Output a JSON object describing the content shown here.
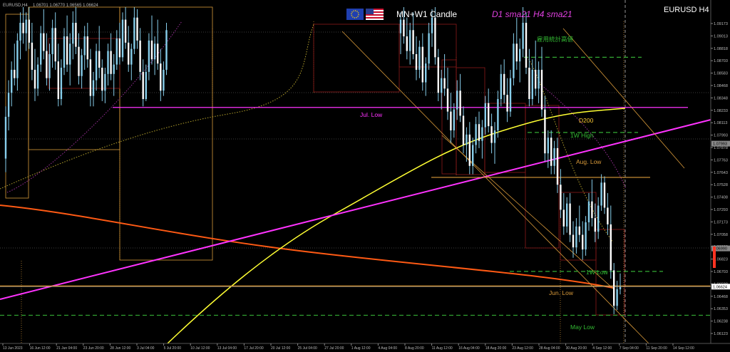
{
  "window": {
    "symbol_header": "EURUSD,H4",
    "ohlc_readout": "1.06701 1.06770 1.06565 1.06624",
    "symbol_title": "EURUSD H4",
    "indicator_label_1": "MN+W1 Candle",
    "indicator_label_2": "D1 sma21 H4 sma21"
  },
  "colors": {
    "background": "#000000",
    "candle": "#87ceeb",
    "magenta_line": "#ff33ff",
    "yellow_ma": "#ffff33",
    "orange_ma": "#ff5a14",
    "level_orange": "#d99a3a",
    "level_green": "#33aa33",
    "box_red": "#8b1a1a",
    "dotted_olive": "#b5a22c",
    "dotted_purple": "#9a2f9a"
  },
  "chart_data": {
    "type": "candlestick",
    "title": "EURUSD H4",
    "ylim": [
      1.0608,
      1.093
    ],
    "y_ticks": [
      "1.09173",
      "1.09013",
      "1.08818",
      "1.08703",
      "1.08583",
      "1.08468",
      "1.08348",
      "1.08233",
      "1.08113",
      "1.07993",
      "1.07878",
      "1.07763",
      "1.07643",
      "1.07528",
      "1.07408",
      "1.07293",
      "1.07173",
      "1.07058",
      "1.06938",
      "1.06823",
      "1.06703",
      "1.06588",
      "1.06468",
      "1.06353",
      "1.06238",
      "1.06123"
    ],
    "x_ticks": [
      "13 Jun 2023",
      "16 Jun 12:00",
      "21 Jun 04:00",
      "23 Jun 20:00",
      "28 Jun 12:00",
      "3 Jul 04:00",
      "5 Jul 20:00",
      "10 Jul 12:00",
      "13 Jul 04:00",
      "17 Jul 20:00",
      "20 Jul 12:00",
      "25 Jul 04:00",
      "27 Jul 20:00",
      "1 Aug 12:00",
      "4 Aug 04:00",
      "8 Aug 20:00",
      "11 Aug 12:00",
      "16 Aug 04:00",
      "18 Aug 20:00",
      "23 Aug 12:00",
      "28 Aug 04:00",
      "30 Aug 20:00",
      "4 Sep 12:00",
      "7 Sep 04:00",
      "11 Sep 20:00",
      "14 Sep 12:00"
    ],
    "current_price": "1.06624",
    "price_markers": [
      "1.07993",
      "1.06990"
    ],
    "levels": [
      {
        "label": "Jul. Low",
        "price": 1.0834,
        "color": "magenta"
      },
      {
        "label": "D200",
        "price": 1.0825,
        "color": "yellow"
      },
      {
        "label": "1W High",
        "price": 1.081,
        "color": "green"
      },
      {
        "label": "Aug. Low",
        "price": 1.0767,
        "color": "orange"
      },
      {
        "label": "1W Low",
        "price": 1.0677,
        "color": "green"
      },
      {
        "label": "Jun. Low",
        "price": 1.0663,
        "color": "orange"
      },
      {
        "label": "May Low",
        "price": 1.0635,
        "color": "green"
      },
      {
        "label": "雇用統計高値",
        "price": 1.0882,
        "color": "green"
      }
    ],
    "candles": [
      [
        1.0785,
        1.0835,
        1.0772,
        1.0825
      ],
      [
        1.0825,
        1.086,
        1.0812,
        1.0848
      ],
      [
        1.0848,
        1.0878,
        1.0835,
        1.087
      ],
      [
        1.087,
        1.0895,
        1.0855,
        1.0862
      ],
      [
        1.0862,
        1.0905,
        1.085,
        1.0898
      ],
      [
        1.0898,
        1.0925,
        1.088,
        1.0915
      ],
      [
        1.0915,
        1.093,
        1.0895,
        1.0905
      ],
      [
        1.0905,
        1.0925,
        1.0888,
        1.0918
      ],
      [
        1.0918,
        1.093,
        1.089,
        1.0896
      ],
      [
        1.0896,
        1.0915,
        1.086,
        1.087
      ],
      [
        1.087,
        1.089,
        1.084,
        1.0852
      ],
      [
        1.0852,
        1.0882,
        1.0845,
        1.0875
      ],
      [
        1.0875,
        1.0912,
        1.0868,
        1.0905
      ],
      [
        1.0905,
        1.0928,
        1.088,
        1.0888
      ],
      [
        1.0888,
        1.0905,
        1.0855,
        1.0862
      ],
      [
        1.0862,
        1.0895,
        1.085,
        1.0885
      ],
      [
        1.0885,
        1.0918,
        1.0872,
        1.091
      ],
      [
        1.091,
        1.0925,
        1.087,
        1.0878
      ],
      [
        1.0878,
        1.0895,
        1.0835,
        1.0842
      ],
      [
        1.0842,
        1.088,
        1.0836,
        1.0872
      ],
      [
        1.0872,
        1.091,
        1.0865,
        1.0902
      ],
      [
        1.0902,
        1.0922,
        1.0868,
        1.0875
      ],
      [
        1.0875,
        1.0905,
        1.0855,
        1.0895
      ],
      [
        1.0895,
        1.0926,
        1.088,
        1.0915
      ],
      [
        1.0915,
        1.093,
        1.0885,
        1.0892
      ],
      [
        1.0892,
        1.0905,
        1.0856,
        1.0864
      ],
      [
        1.0864,
        1.089,
        1.0852,
        1.0884
      ],
      [
        1.0884,
        1.0912,
        1.087,
        1.0902
      ],
      [
        1.0902,
        1.0915,
        1.0872,
        1.088
      ],
      [
        1.088,
        1.089,
        1.0835,
        1.0845
      ],
      [
        1.0845,
        1.0868,
        1.0835,
        1.086
      ],
      [
        1.086,
        1.0895,
        1.085,
        1.0888
      ],
      [
        1.0888,
        1.0912,
        1.0862,
        1.0872
      ],
      [
        1.0872,
        1.088,
        1.084,
        1.085
      ],
      [
        1.085,
        1.0872,
        1.0838,
        1.0866
      ],
      [
        1.0866,
        1.0895,
        1.0855,
        1.0888
      ],
      [
        1.0888,
        1.0905,
        1.086,
        1.0866
      ],
      [
        1.0866,
        1.0885,
        1.0845,
        1.0875
      ],
      [
        1.0875,
        1.0908,
        1.087,
        1.09
      ],
      [
        1.09,
        1.0915,
        1.0875,
        1.0882
      ],
      [
        1.0882,
        1.0925,
        1.0878,
        1.0918
      ],
      [
        1.0918,
        1.093,
        1.089,
        1.0896
      ],
      [
        1.0896,
        1.0912,
        1.0868,
        1.0875
      ],
      [
        1.0875,
        1.0895,
        1.086,
        1.089
      ],
      [
        1.089,
        1.093,
        1.0885,
        1.092
      ],
      [
        1.092,
        1.0928,
        1.089,
        1.0898
      ],
      [
        1.0898,
        1.091,
        1.086,
        1.0868
      ],
      [
        1.0868,
        1.088,
        1.0835,
        1.0842
      ],
      [
        1.0842,
        1.0875,
        1.084,
        1.0868
      ],
      [
        1.0868,
        1.0905,
        1.086,
        1.0898
      ],
      [
        1.0898,
        1.0922,
        1.0875,
        1.088
      ],
      [
        1.088,
        1.0902,
        1.0865,
        1.0895
      ],
      [
        1.0895,
        1.0918,
        1.087,
        1.0876
      ],
      [
        1.0876,
        1.089,
        1.084,
        1.085
      ],
      [
        1.085,
        1.0878,
        1.0845,
        1.087
      ],
      [
        1.087,
        1.0915,
        1.0865,
        1.0908
      ]
    ],
    "candles_2": [
      [
        1.0905,
        1.0925,
        1.0885,
        1.0918
      ],
      [
        1.0918,
        1.093,
        1.0895,
        1.0902
      ],
      [
        1.0902,
        1.092,
        1.088,
        1.0888
      ],
      [
        1.0888,
        1.0915,
        1.0875,
        1.0908
      ],
      [
        1.0908,
        1.0925,
        1.088,
        1.0885
      ],
      [
        1.0885,
        1.0902,
        1.086,
        1.087
      ],
      [
        1.087,
        1.0898,
        1.0862,
        1.0892
      ],
      [
        1.0892,
        1.0905,
        1.085,
        1.0858
      ],
      [
        1.0858,
        1.0882,
        1.0845,
        1.0876
      ],
      [
        1.0876,
        1.0915,
        1.087,
        1.0905
      ],
      [
        1.0905,
        1.0928,
        1.0892,
        1.092
      ],
      [
        1.092,
        1.093,
        1.0875,
        1.0882
      ],
      [
        1.0882,
        1.089,
        1.084,
        1.0848
      ],
      [
        1.0848,
        1.087,
        1.0832,
        1.0862
      ],
      [
        1.0862,
        1.0885,
        1.0845,
        1.0852
      ],
      [
        1.0852,
        1.0872,
        1.0822,
        1.083
      ],
      [
        1.083,
        1.0848,
        1.08,
        1.0812
      ],
      [
        1.0812,
        1.0838,
        1.0805,
        1.0832
      ],
      [
        1.0832,
        1.086,
        1.0822,
        1.085
      ],
      [
        1.085,
        1.0866,
        1.082,
        1.0826
      ],
      [
        1.0826,
        1.0835,
        1.079,
        1.0798
      ],
      [
        1.0798,
        1.0815,
        1.0782,
        1.0808
      ],
      [
        1.0808,
        1.082,
        1.077,
        1.0778
      ],
      [
        1.0778,
        1.0805,
        1.077,
        1.0798
      ],
      [
        1.0798,
        1.0825,
        1.079,
        1.0818
      ],
      [
        1.0818,
        1.083,
        1.0795,
        1.0802
      ],
      [
        1.0802,
        1.0822,
        1.0785,
        1.0815
      ],
      [
        1.0815,
        1.0845,
        1.0808,
        1.0838
      ],
      [
        1.0838,
        1.0852,
        1.081,
        1.0816
      ],
      [
        1.0816,
        1.0828,
        1.079,
        1.08
      ],
      [
        1.08,
        1.082,
        1.078,
        1.0812
      ],
      [
        1.0812,
        1.085,
        1.0805,
        1.0842
      ],
      [
        1.0842,
        1.0875,
        1.0835,
        1.0866
      ],
      [
        1.0866,
        1.088,
        1.0838,
        1.0846
      ],
      [
        1.0846,
        1.0862,
        1.082,
        1.083
      ],
      [
        1.083,
        1.087,
        1.0825,
        1.0862
      ],
      [
        1.0862,
        1.0905,
        1.0855,
        1.0895
      ],
      [
        1.0895,
        1.092,
        1.087,
        1.0878
      ],
      [
        1.0878,
        1.09,
        1.0858,
        1.089
      ],
      [
        1.089,
        1.093,
        1.0882,
        1.0915
      ],
      [
        1.0915,
        1.0925,
        1.0866,
        1.0872
      ],
      [
        1.0872,
        1.089,
        1.0835,
        1.0842
      ],
      [
        1.0842,
        1.088,
        1.0836,
        1.087
      ],
      [
        1.087,
        1.0898,
        1.0845,
        1.0852
      ],
      [
        1.0852,
        1.0878,
        1.0838,
        1.087
      ],
      [
        1.087,
        1.0892,
        1.0825,
        1.0832
      ],
      [
        1.0832,
        1.0845,
        1.0782,
        1.079
      ],
      [
        1.079,
        1.0812,
        1.0776,
        1.0805
      ],
      [
        1.0805,
        1.0812,
        1.077,
        1.0778
      ],
      [
        1.0778,
        1.0802,
        1.077,
        1.0795
      ],
      [
        1.0795,
        1.0805,
        1.0752,
        1.076
      ],
      [
        1.076,
        1.0775,
        1.0728,
        1.0736
      ],
      [
        1.0736,
        1.0752,
        1.0712,
        1.072
      ],
      [
        1.072,
        1.0748,
        1.0714,
        1.0742
      ],
      [
        1.0742,
        1.0752,
        1.0705,
        1.0712
      ],
      [
        1.0712,
        1.0725,
        1.069,
        1.07
      ],
      [
        1.07,
        1.0728,
        1.0694,
        1.072
      ],
      [
        1.072,
        1.074,
        1.0705,
        1.0712
      ],
      [
        1.0712,
        1.0725,
        1.0688,
        1.0698
      ],
      [
        1.0698,
        1.073,
        1.0692,
        1.0724
      ],
      [
        1.0724,
        1.0752,
        1.0716,
        1.0744
      ],
      [
        1.0744,
        1.0765,
        1.072,
        1.0728
      ],
      [
        1.0728,
        1.0742,
        1.0705,
        1.0715
      ],
      [
        1.0715,
        1.0748,
        1.0708,
        1.074
      ],
      [
        1.074,
        1.077,
        1.0735,
        1.0762
      ],
      [
        1.0762,
        1.0768,
        1.0732,
        1.0738
      ],
      [
        1.0738,
        1.0752,
        1.0712,
        1.0722
      ],
      [
        1.0722,
        1.074,
        1.067,
        1.0678
      ],
      [
        1.0678,
        1.0685,
        1.0636,
        1.0644
      ],
      [
        1.0644,
        1.0668,
        1.064,
        1.066
      ],
      [
        1.066,
        1.0675,
        1.0655,
        1.0662
      ]
    ]
  }
}
